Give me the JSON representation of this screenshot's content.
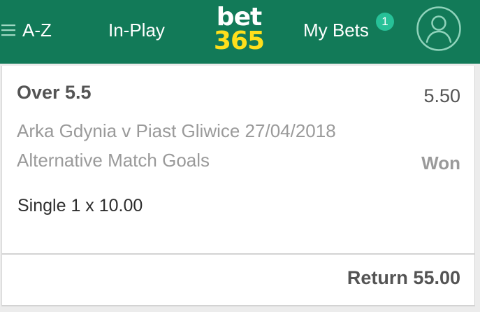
{
  "nav": {
    "az_label": "A-Z",
    "inplay_label": "In-Play",
    "mybets_label": "My Bets",
    "mybets_count": "1",
    "logo_top": "bet",
    "logo_bottom": "365"
  },
  "bet": {
    "selection": "Over 5.5",
    "odds": "5.50",
    "fixture": "Arka Gdynia v Piast Gliwice 27/04/2018",
    "market": "Alternative Match Goals",
    "status": "Won",
    "stake": "Single 1 x 10.00",
    "return": "Return 55.00"
  },
  "colors": {
    "header_green": "#127a58",
    "logo_yellow": "#ffdf1b",
    "badge_green": "#27c198",
    "text_dark": "#545454",
    "text_muted": "#9a9a9a"
  },
  "icons": {
    "menu": "hamburger-icon",
    "account": "user-avatar-icon"
  }
}
